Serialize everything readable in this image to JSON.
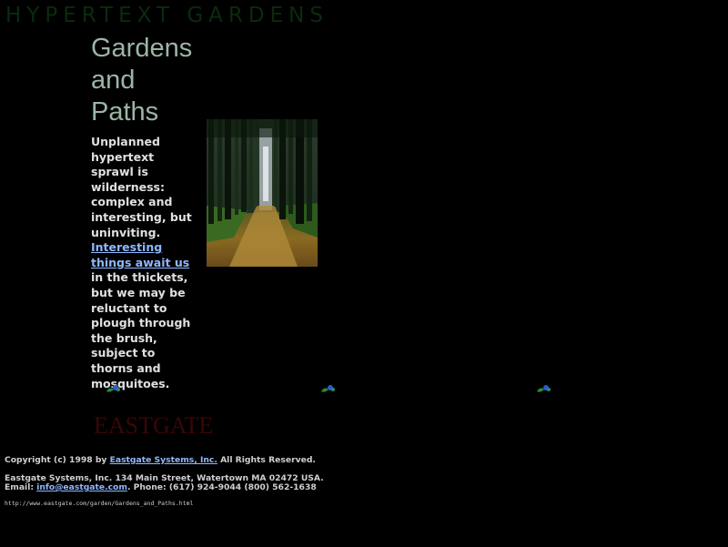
{
  "banner": "HYPERTEXT GARDENS",
  "title": [
    "Gardens",
    "and",
    "Paths"
  ],
  "paragraph": {
    "before_link": "Unplanned hypertext sprawl is wilderness: complex and interesting, but uninviting.",
    "link": "Interesting things await us",
    "after_link": "in the thickets, but we may be reluctant to plough through the brush, subject to thorns and mosquitoes."
  },
  "image": {
    "subject": "forest path between tall trees"
  },
  "divider_icon": "leaf-ornament-icon",
  "logo": "EASTGATE",
  "footer": {
    "copyright_prefix": "Copyright (c) 1998 by",
    "company_link": "Eastgate Systems, Inc.",
    "copyright_suffix": "All Rights Reserved.",
    "address": "Eastgate Systems, Inc. 134 Main Street, Watertown MA 02472 USA.",
    "email_label": "Email:",
    "email_link": "info@eastgate.com",
    "phone": ". Phone: (617) 924-9044 (800) 562-1638",
    "url": "http://www.eastgate.com/garden/Gardens_and_Paths.html"
  },
  "colors": {
    "background": "#000000",
    "title": "#9cb5a6",
    "link": "#8fb8ff",
    "banner": "#0c2a0e",
    "logo": "#3b0606"
  }
}
